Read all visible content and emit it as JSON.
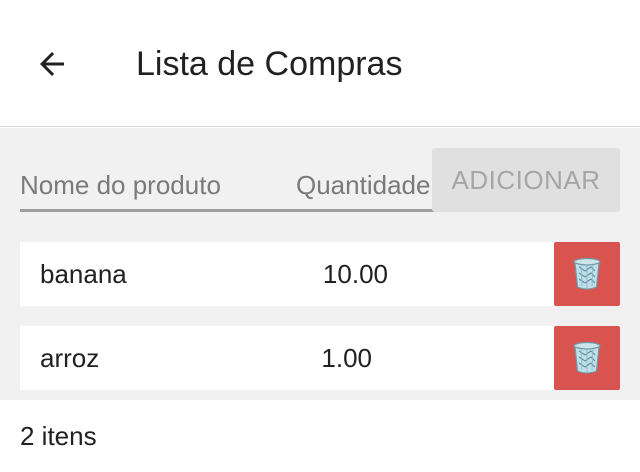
{
  "header": {
    "back_icon": "arrow-left-icon",
    "title": "Lista de Compras"
  },
  "form": {
    "name_placeholder": "Nome do produto",
    "quantity_placeholder": "Quantidade",
    "add_label": "ADICIONAR"
  },
  "items": [
    {
      "name": "banana",
      "quantity": "10.00",
      "delete_icon": "trash-icon"
    },
    {
      "name": "arroz",
      "quantity": "1.00",
      "delete_icon": "trash-icon"
    }
  ],
  "footer": {
    "count_text": "2 itens"
  },
  "colors": {
    "delete": "#d9534f",
    "add_button_disabled": "#e0e0e0",
    "content_bg": "#f1f1f1"
  }
}
